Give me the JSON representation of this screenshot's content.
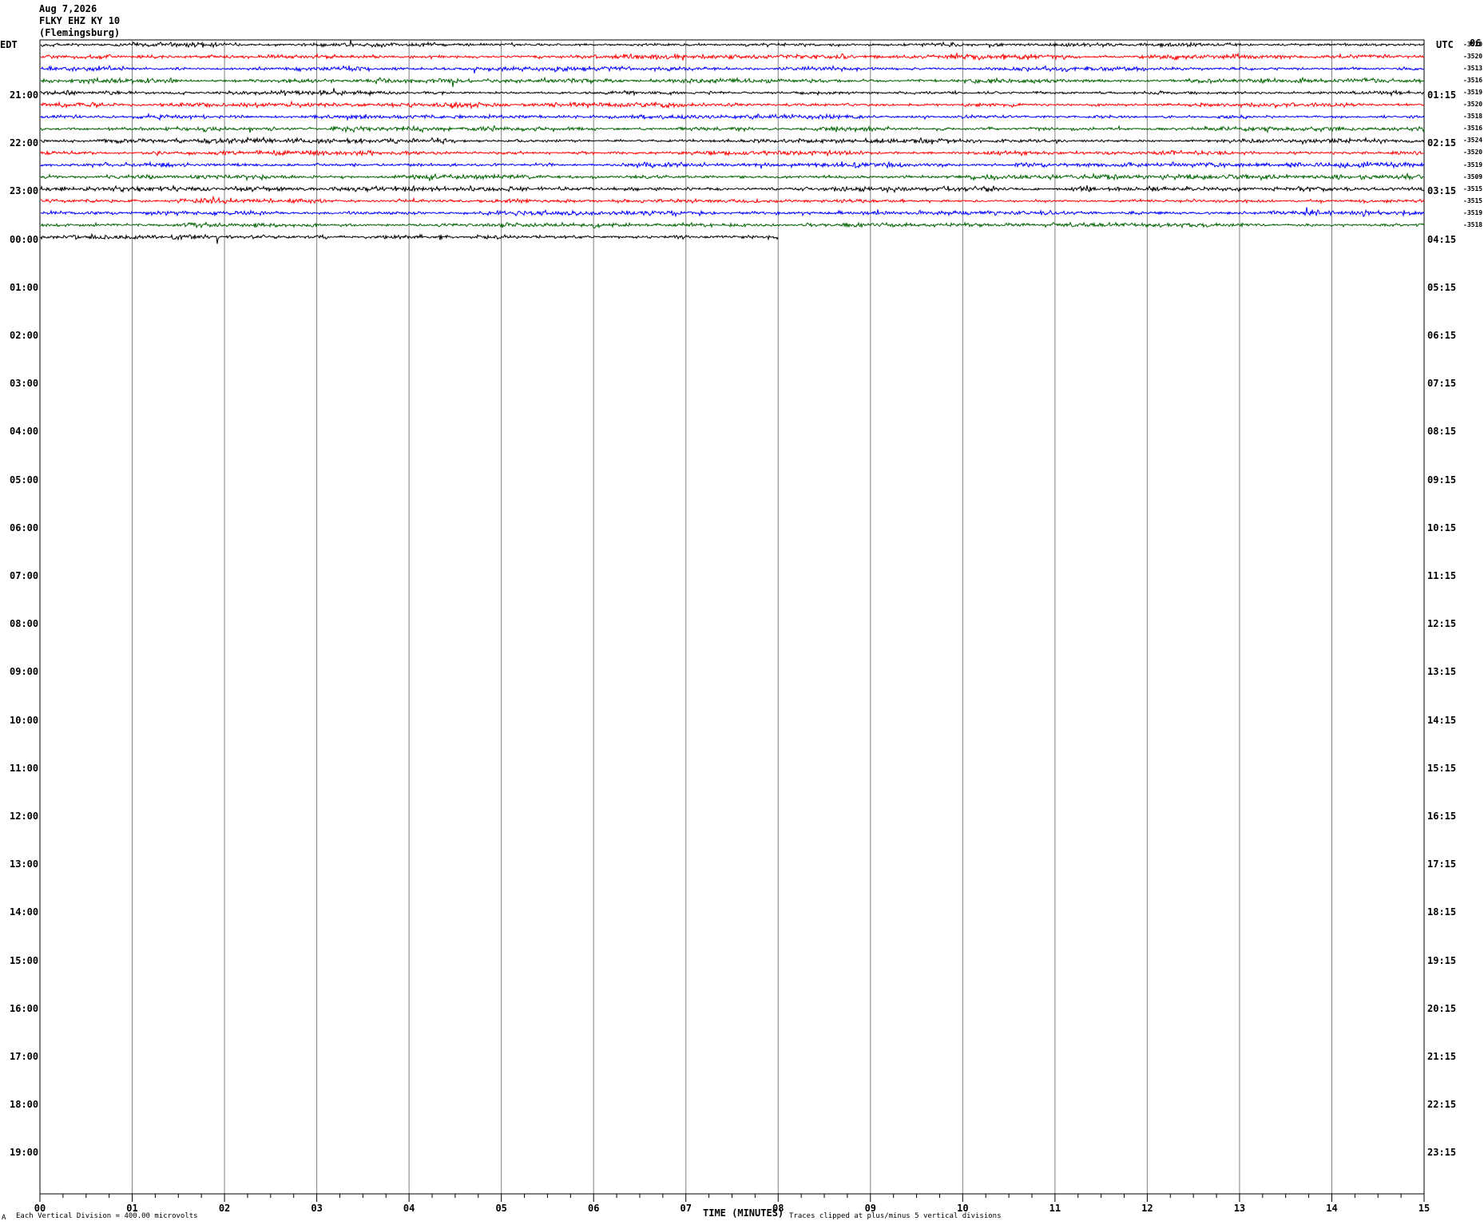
{
  "header": {
    "date": "Aug 7,2026",
    "station": "FLKY EHZ KY 10",
    "location": "(Flemingsburg)"
  },
  "left_tz": "EDT",
  "right_tz": "UTC",
  "top_right_note": "06",
  "footer": {
    "corner_mark": "A",
    "vertical_division": "Each Vertical Division =  400.00 microvolts",
    "clip_note": "Traces clipped at plus/minus 5 vertical divisions"
  },
  "colors": {
    "black": "#000000",
    "red": "#ff0000",
    "blue": "#0000ff",
    "green": "#006400",
    "grid": "#808080"
  },
  "chart_data": {
    "type": "line",
    "title": "FLKY EHZ KY 10",
    "xlabel": "TIME (MINUTES)",
    "xlim": [
      0,
      15
    ],
    "x_ticks": [
      "00",
      "01",
      "02",
      "03",
      "04",
      "05",
      "06",
      "07",
      "08",
      "09",
      "10",
      "11",
      "12",
      "13",
      "14",
      "15"
    ],
    "left_hour_labels": [
      "21:00",
      "22:00",
      "23:00",
      "00:00",
      "01:00",
      "02:00",
      "03:00",
      "04:00",
      "05:00",
      "06:00",
      "07:00",
      "08:00",
      "09:00",
      "10:00",
      "11:00",
      "12:00",
      "13:00",
      "14:00",
      "15:00",
      "16:00",
      "17:00",
      "18:00",
      "19:00"
    ],
    "right_hour_labels": [
      "01:15",
      "02:15",
      "03:15",
      "04:15",
      "05:15",
      "06:15",
      "07:15",
      "08:15",
      "09:15",
      "10:15",
      "11:15",
      "12:15",
      "13:15",
      "14:15",
      "15:15",
      "16:15",
      "17:15",
      "18:15",
      "19:15",
      "20:15",
      "21:15",
      "22:15",
      "23:15"
    ],
    "trace_colors": [
      "black",
      "red",
      "blue",
      "green"
    ],
    "trace_end_minutes": [
      15,
      15,
      15,
      15,
      15,
      15,
      15,
      15,
      15,
      15,
      15,
      15,
      15,
      15,
      15,
      15,
      8
    ],
    "trace_offsets": [
      "-3520",
      "-3520",
      "-3513",
      "-3516",
      "-3519",
      "-3520",
      "-3518",
      "-3516",
      "-3524",
      "-3520",
      "-3519",
      "-3509",
      "-3515",
      "-3515",
      "-3519",
      "-3518"
    ]
  }
}
